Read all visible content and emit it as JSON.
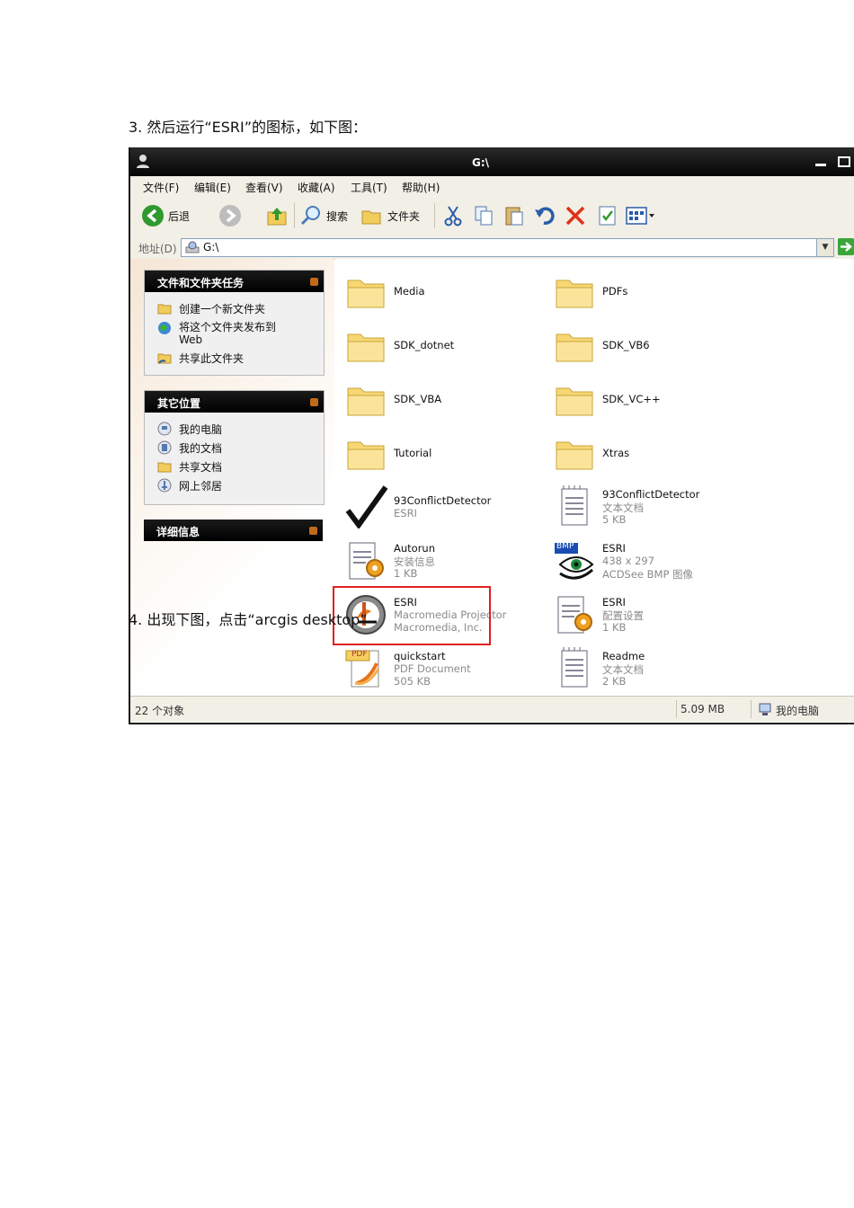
{
  "doc": {
    "step3": "3.  然后运行“ESRI”的图标，如下图：",
    "step4": "4.  出现下图，点击“arcgis desktop”"
  },
  "window": {
    "title": "G:\\",
    "menu": [
      "文件(F)",
      "编辑(E)",
      "查看(V)",
      "收藏(A)",
      "工具(T)",
      "帮助(H)"
    ],
    "toolbar": {
      "back": "后退",
      "search": "搜索",
      "folders": "文件夹"
    },
    "address": {
      "label": "地址(D)",
      "value": "G:\\"
    },
    "side": {
      "tasks_title": "文件和文件夹任务",
      "tasks": [
        "创建一个新文件夹",
        "将这个文件夹发布到",
        "Web",
        "共享此文件夹"
      ],
      "places_title": "其它位置",
      "places": [
        "我的电脑",
        "我的文档",
        "共享文档",
        "网上邻居"
      ],
      "details_title": "详细信息"
    },
    "files": [
      {
        "name": "Media"
      },
      {
        "name": "PDFs"
      },
      {
        "name": "SDK_dotnet"
      },
      {
        "name": "SDK_VB6"
      },
      {
        "name": "SDK_VBA"
      },
      {
        "name": "SDK_VC++"
      },
      {
        "name": "Tutorial"
      },
      {
        "name": "Xtras"
      },
      {
        "name": "93ConflictDetector",
        "line1": "ESRI"
      },
      {
        "name": "93ConflictDetector",
        "line1": "文本文档",
        "line2": "5 KB"
      },
      {
        "name": "Autorun",
        "line1": "安装信息",
        "line2": "1 KB"
      },
      {
        "name": "ESRI",
        "line1": "438 x 297",
        "line2": "ACDSee BMP 图像",
        "badge": "BMP"
      },
      {
        "name": "ESRI",
        "line1": "Macromedia Projector",
        "line2": "Macromedia, Inc."
      },
      {
        "name": "ESRI",
        "line1": "配置设置",
        "line2": "1 KB"
      },
      {
        "name": "quickstart",
        "line1": "PDF Document",
        "line2": "505 KB",
        "badge": "PDF"
      },
      {
        "name": "Readme",
        "line1": "文本文档",
        "line2": "2 KB"
      }
    ],
    "status": {
      "count": "22 个对象",
      "size": "5.09 MB",
      "location": "我的电脑"
    }
  },
  "colors": {
    "highlight": "#e02020",
    "titlebar": "#000000",
    "folder": "#f7d774"
  }
}
